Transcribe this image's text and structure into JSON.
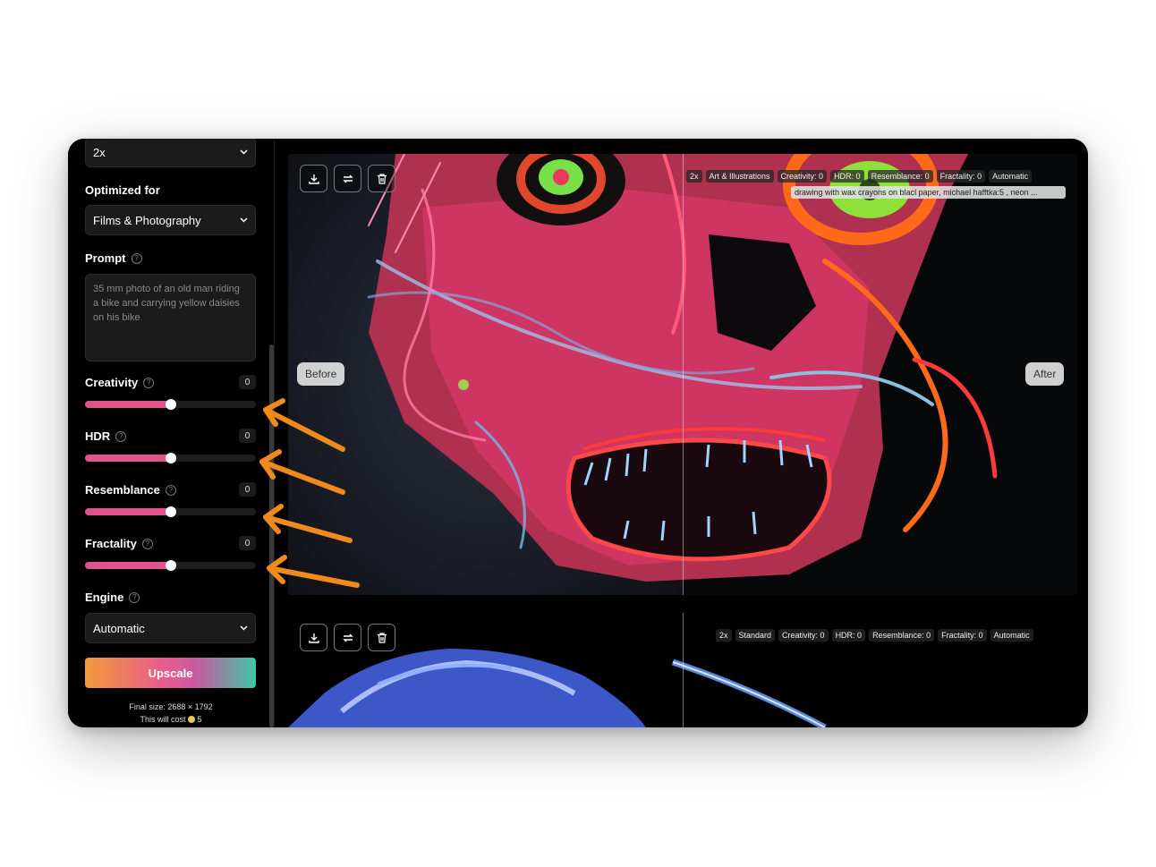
{
  "sidebar": {
    "scale_value": "2x",
    "optimized_for": {
      "label": "Optimized for",
      "value": "Films & Photography"
    },
    "prompt": {
      "label": "Prompt",
      "placeholder": "35 mm photo of an old man riding a bike and carrying yellow daisies on his bike"
    },
    "sliders": [
      {
        "label": "Creativity",
        "value": "0",
        "fill_fraction": 0.5
      },
      {
        "label": "HDR",
        "value": "0",
        "fill_fraction": 0.5
      },
      {
        "label": "Resemblance",
        "value": "0",
        "fill_fraction": 0.5
      },
      {
        "label": "Fractality",
        "value": "0",
        "fill_fraction": 0.5
      }
    ],
    "engine": {
      "label": "Engine",
      "value": "Automatic"
    },
    "upscale_label": "Upscale",
    "final_size": "Final size: 2688 × 1792",
    "cost_prefix": "This will cost",
    "cost_value": "5",
    "help_glyph": "?"
  },
  "result1": {
    "before_label": "Before",
    "after_label": "After",
    "tags": [
      "2x",
      "Art & Illustrations",
      "Creativity: 0",
      "HDR: 0",
      "Resemblance: 0",
      "Fractality: 0",
      "Automatic"
    ],
    "caption": "drawing with wax crayons on blacl paper, michael hafftka:5 , neon ..."
  },
  "result2": {
    "tags": [
      "2x",
      "Standard",
      "Creativity: 0",
      "HDR: 0",
      "Resemblance: 0",
      "Fractality: 0",
      "Automatic"
    ]
  },
  "icons": [
    "chevron-down-icon",
    "help-icon",
    "download-icon",
    "swap-icon",
    "trash-icon",
    "coin-icon"
  ],
  "colors": {
    "accent_pink": "#e0528b",
    "annotation_arrow": "#f08a1e",
    "background": "#000000"
  }
}
